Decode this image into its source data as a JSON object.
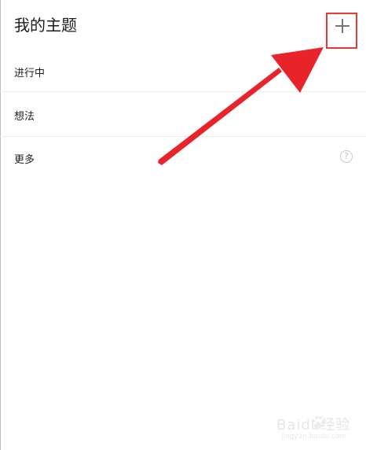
{
  "header": {
    "title": "我的主题",
    "add_icon": "plus-icon"
  },
  "menu": {
    "items": [
      {
        "label": "进行中"
      },
      {
        "label": "想法"
      },
      {
        "label": "更多",
        "icon": "help-icon",
        "icon_glyph": "?"
      }
    ]
  },
  "annotation": {
    "arrow_color": "#e8232a",
    "highlight_color": "#e53935"
  },
  "watermark": {
    "brand": "Baidu经验",
    "url": "jingyan.baidu.com"
  }
}
